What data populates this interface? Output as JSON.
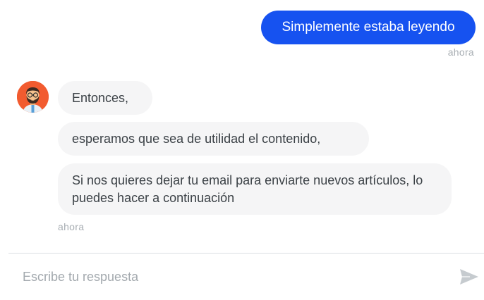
{
  "conversation": {
    "user_message": {
      "text": "Simplemente estaba leyendo",
      "time": "ahora"
    },
    "bot_messages": [
      {
        "text": "Entonces,"
      },
      {
        "text": "esperamos que sea de utilidad el contenido,"
      },
      {
        "text": "Si nos quieres dejar tu email para enviarte nuevos artículos, lo puedes hacer a continuación"
      }
    ],
    "bot_time": "ahora",
    "bot_avatar_icon": "bearded-man-avatar"
  },
  "composer": {
    "placeholder": "Escribe tu respuesta",
    "value": "",
    "send_icon": "send-icon"
  },
  "colors": {
    "user_bubble": "#1652f0",
    "bot_bubble": "#f5f5f6",
    "avatar_bg": "#f25b2f",
    "send_icon": "#c6cbcf"
  }
}
